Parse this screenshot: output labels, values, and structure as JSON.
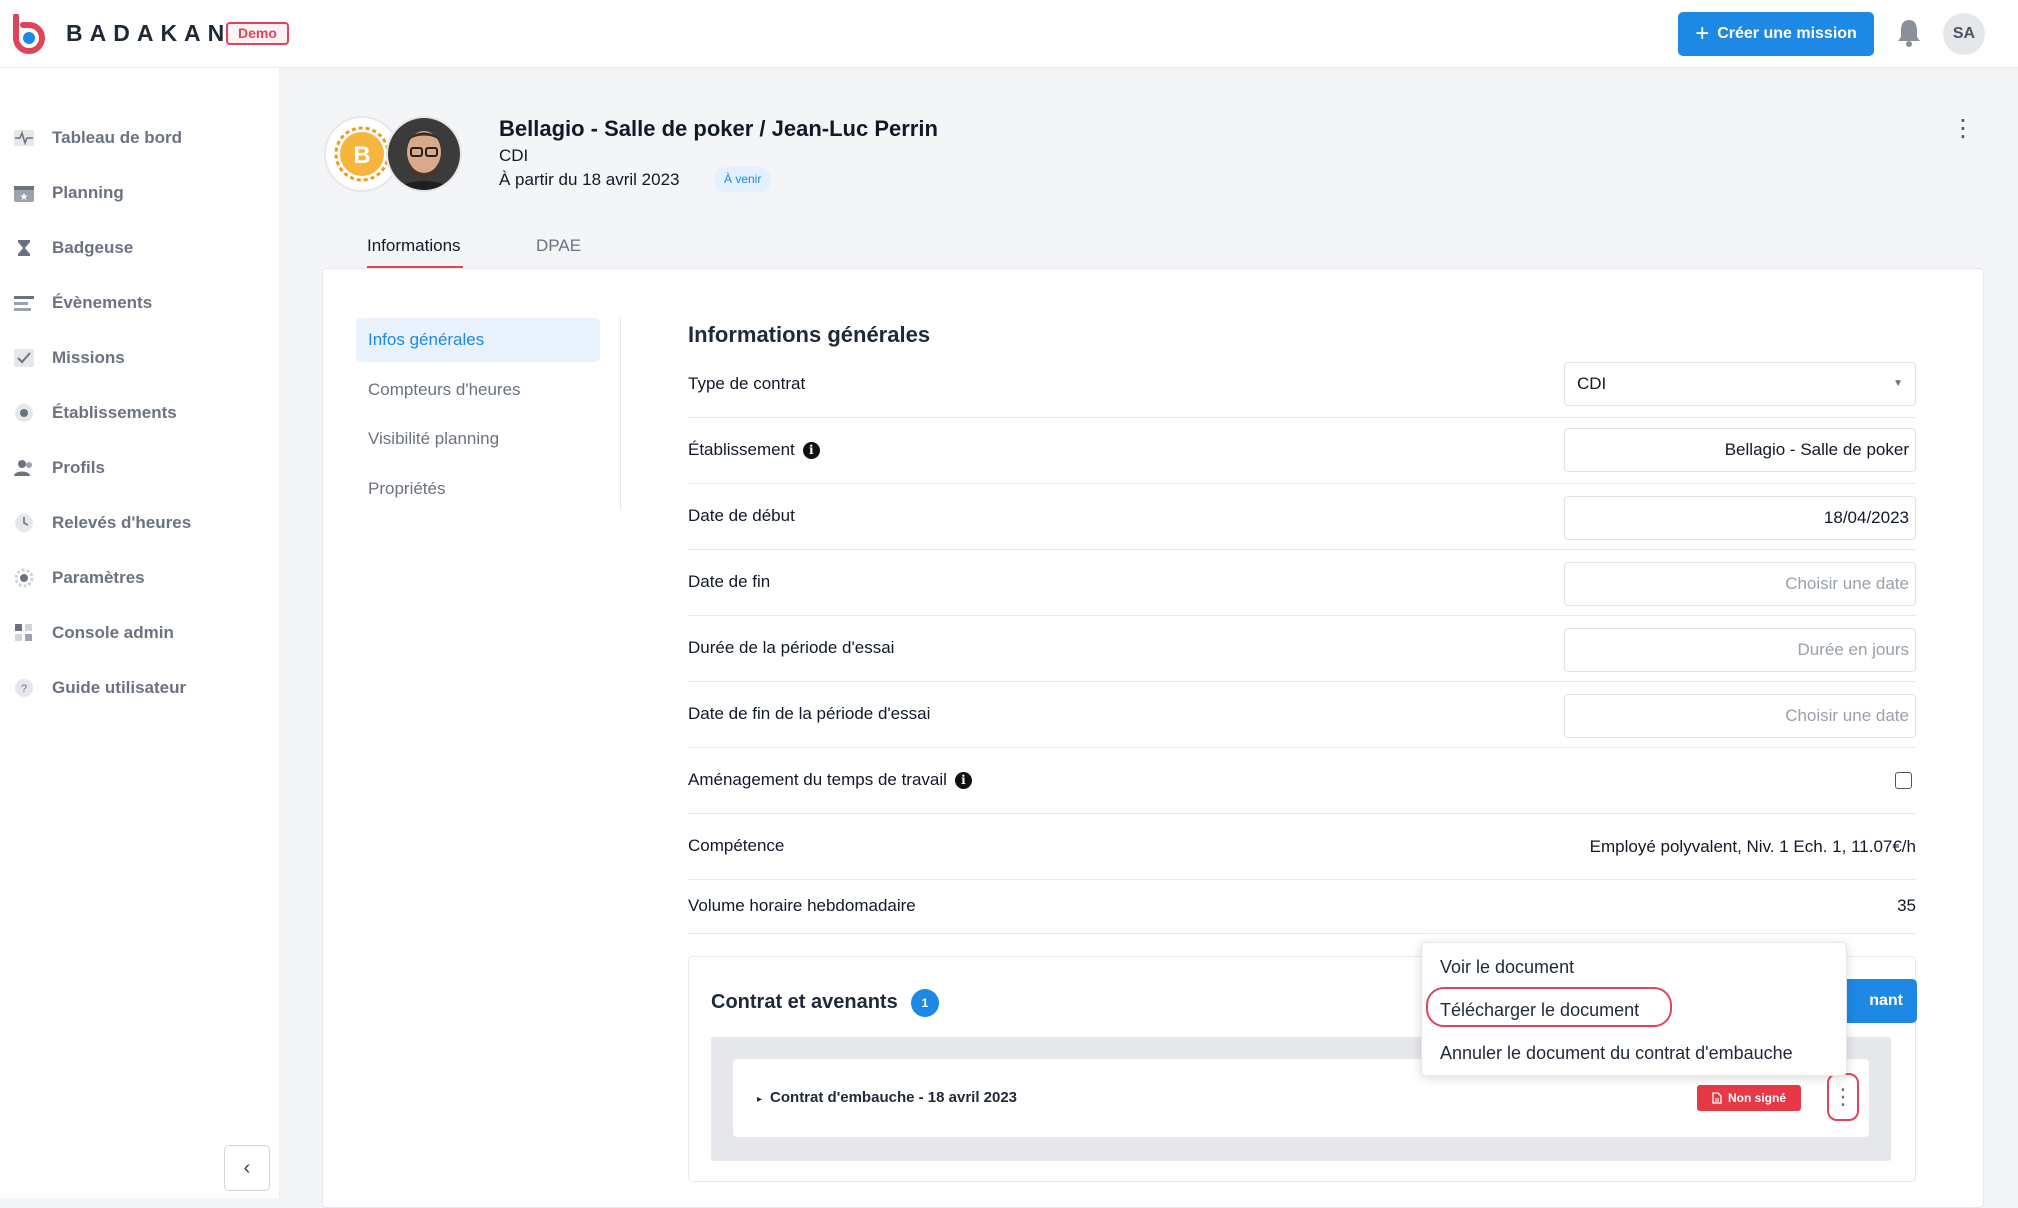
{
  "app": {
    "brand": "BADAKAN",
    "env_badge": "Demo",
    "create_button": "Créer une mission",
    "user_initials": "SA",
    "accent": "#1e88e5",
    "danger": "#e0445a"
  },
  "sidebar": {
    "items": [
      {
        "label": "Tableau de bord",
        "icon": "pulse-icon"
      },
      {
        "label": "Planning",
        "icon": "calendar-star-icon"
      },
      {
        "label": "Badgeuse",
        "icon": "hourglass-icon"
      },
      {
        "label": "Évènements",
        "icon": "list-icon"
      },
      {
        "label": "Missions",
        "icon": "checklist-icon"
      },
      {
        "label": "Établissements",
        "icon": "building-icon"
      },
      {
        "label": "Profils",
        "icon": "users-icon"
      },
      {
        "label": "Relevés d'heures",
        "icon": "clock-icon"
      },
      {
        "label": "Paramètres",
        "icon": "gear-icon"
      },
      {
        "label": "Console admin",
        "icon": "grid-icon"
      },
      {
        "label": "Guide utilisateur",
        "icon": "help-icon"
      }
    ],
    "collapse_icon": "‹"
  },
  "header": {
    "title": "Bellagio - Salle de poker / Jean-Luc Perrin",
    "contract_type": "CDI",
    "start_text": "À partir du 18 avril 2023",
    "status": "À venir"
  },
  "tabs": [
    {
      "label": "Informations",
      "active": true
    },
    {
      "label": "DPAE",
      "active": false
    }
  ],
  "subnav": [
    {
      "label": "Infos générales",
      "active": true
    },
    {
      "label": "Compteurs d'heures"
    },
    {
      "label": "Visibilité planning"
    },
    {
      "label": "Propriétés"
    }
  ],
  "section": {
    "title": "Informations générales",
    "fields": {
      "contract_type": {
        "label": "Type de contrat",
        "value": "CDI"
      },
      "establishment": {
        "label": "Établissement",
        "value": "Bellagio - Salle de poker"
      },
      "start_date": {
        "label": "Date de début",
        "value": "18/04/2023"
      },
      "end_date": {
        "label": "Date de fin",
        "placeholder": "Choisir une date"
      },
      "trial_duration": {
        "label": "Durée de la période d'essai",
        "placeholder": "Durée en jours"
      },
      "trial_end": {
        "label": "Date de fin de la période d'essai",
        "placeholder": "Choisir une date"
      },
      "work_time": {
        "label": "Aménagement du temps de travail",
        "checked": false
      },
      "skill": {
        "label": "Compétence",
        "value": "Employé polyvalent, Niv. 1 Ech. 1, 11.07€/h"
      },
      "weekly_hours": {
        "label": "Volume horaire hebdomadaire",
        "value": "35"
      }
    }
  },
  "contracts": {
    "title": "Contrat et avenants",
    "count": "1",
    "add_button_partial": "nant",
    "row": {
      "label": "Contrat d'embauche - 18 avril 2023",
      "status": "Non signé"
    }
  },
  "dropdown": {
    "items": [
      "Voir le document",
      "Télécharger le document",
      "Annuler le document du contrat d'embauche"
    ]
  }
}
